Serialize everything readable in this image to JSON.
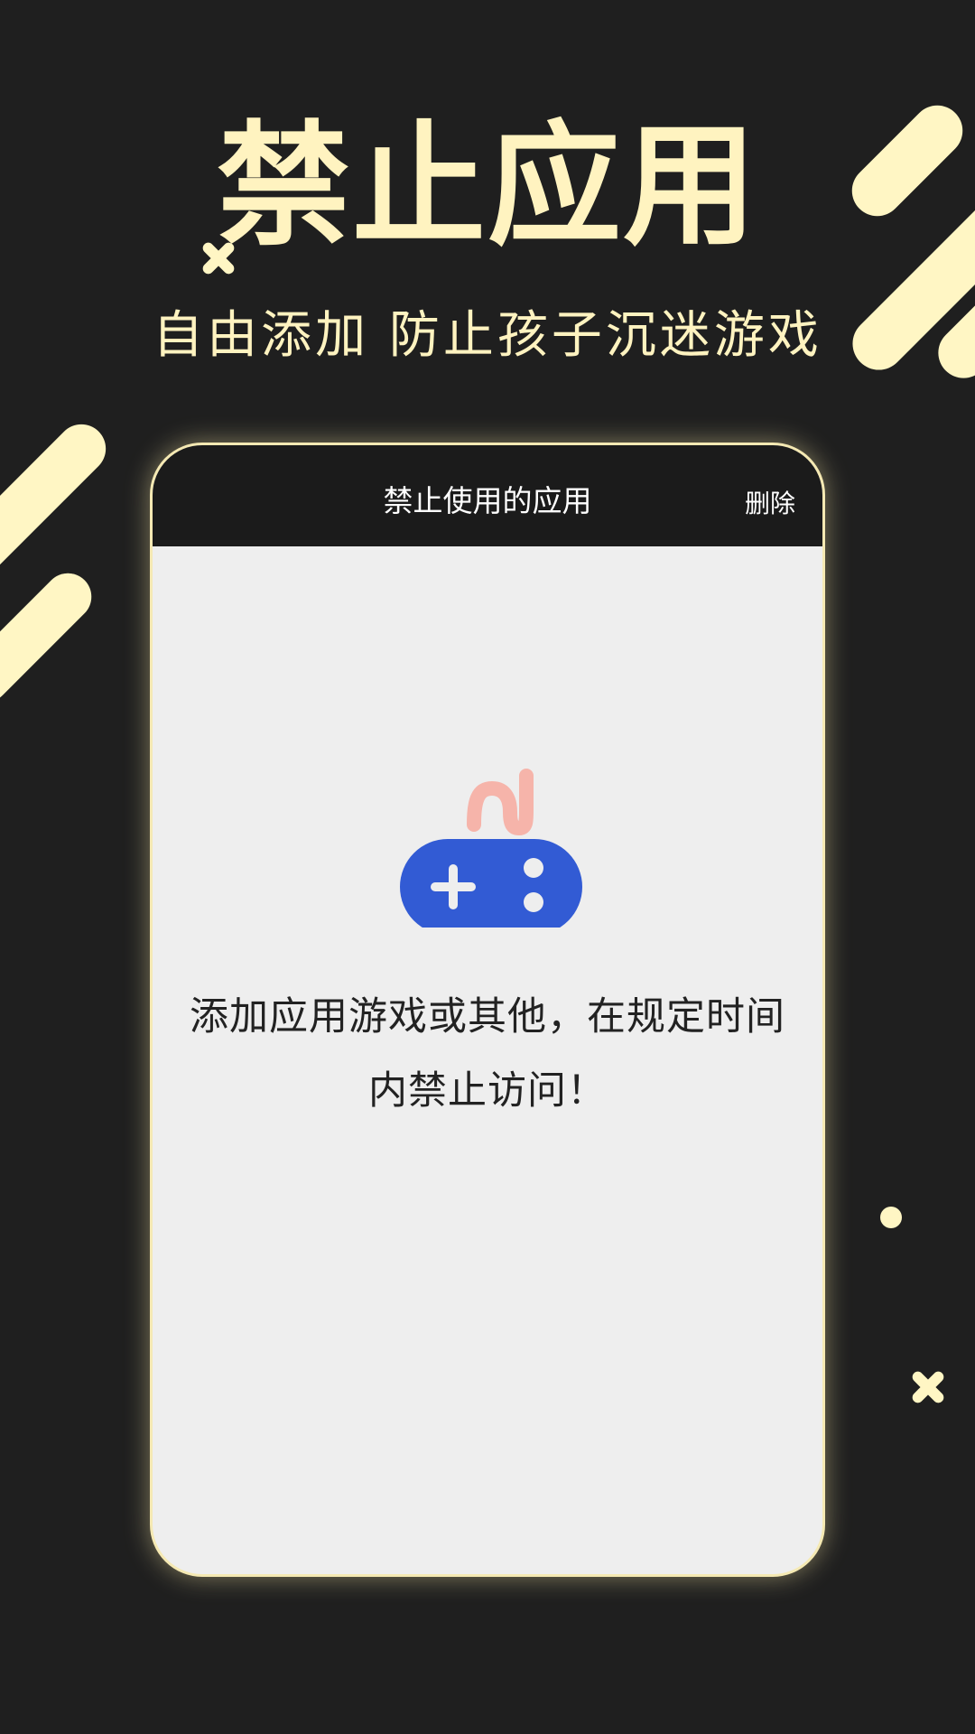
{
  "hero": {
    "title": "禁止应用",
    "subtitle": "自由添加 防止孩子沉迷游戏"
  },
  "app": {
    "header_title": "禁止使用的应用",
    "delete_label": "删除"
  },
  "empty_state": {
    "icon": "gamepad-icon",
    "message": "添加应用游戏或其他，在规定时间内禁止访问！"
  },
  "colors": {
    "background": "#1f1f1f",
    "accent": "#fff6c4",
    "header": "#1b1b1b",
    "content": "#eeeeee",
    "gamepad": "#325bd4",
    "cable": "#f6b4aa"
  }
}
